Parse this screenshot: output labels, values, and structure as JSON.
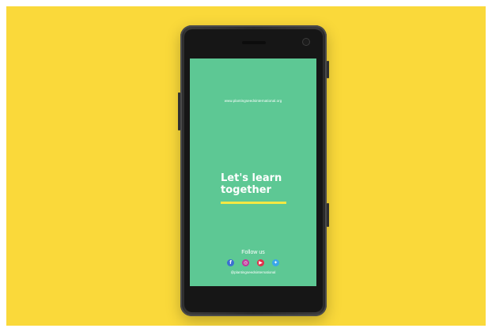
{
  "poster": {
    "website": "www.plantingseedsinternational.org",
    "headline_line1": "Let's learn",
    "headline_line2": "together",
    "follow_label": "Follow us",
    "handle": "@plantingseedsinternational"
  },
  "social_icons": [
    {
      "name": "facebook-icon",
      "glyph": "f",
      "color": "#3B6FD1"
    },
    {
      "name": "instagram-icon",
      "glyph": "◎",
      "color": "#C0359A"
    },
    {
      "name": "youtube-icon",
      "glyph": "▶",
      "color": "#E0304A"
    },
    {
      "name": "twitter-icon",
      "glyph": "✦",
      "color": "#3AA6EA"
    }
  ],
  "colors": {
    "background": "#FAD93A",
    "screen": "#5DC894",
    "accent_underline": "#F4E843",
    "phone_body": "#2B2B2B"
  }
}
